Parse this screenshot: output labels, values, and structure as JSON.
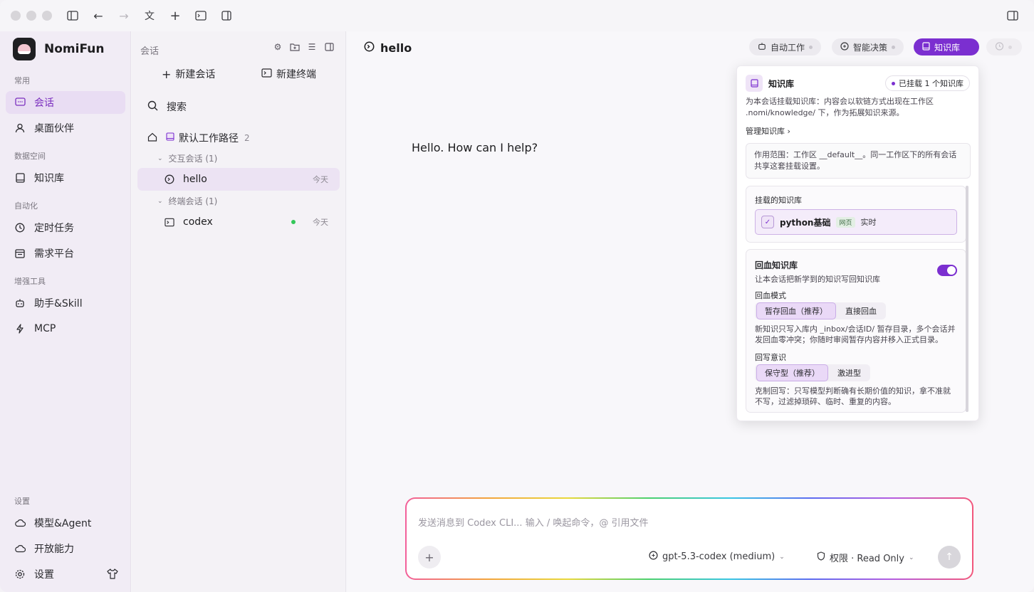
{
  "app": {
    "name": "NomiFun"
  },
  "sidebar": {
    "sections": [
      {
        "label": "常用",
        "items": [
          {
            "label": "会话",
            "icon": "chat-icon",
            "active": true
          },
          {
            "label": "桌面伙伴",
            "icon": "user-icon"
          }
        ]
      },
      {
        "label": "数据空间",
        "items": [
          {
            "label": "知识库",
            "icon": "book-icon"
          }
        ]
      },
      {
        "label": "自动化",
        "items": [
          {
            "label": "定时任务",
            "icon": "clock-icon"
          },
          {
            "label": "需求平台",
            "icon": "list-icon"
          }
        ]
      },
      {
        "label": "增强工具",
        "items": [
          {
            "label": "助手&Skill",
            "icon": "robot-icon"
          },
          {
            "label": "MCP",
            "icon": "bolt-icon"
          }
        ]
      }
    ],
    "bottom_label": "设置",
    "bottom_items": [
      {
        "label": "模型&Agent",
        "icon": "cloud-icon"
      },
      {
        "label": "开放能力",
        "icon": "cloud-icon"
      },
      {
        "label": "设置",
        "icon": "gear-icon"
      }
    ]
  },
  "panel": {
    "title": "会话",
    "new_session": "新建会话",
    "new_terminal": "新建终端",
    "search": "搜索",
    "workspace": {
      "name": "默认工作路径",
      "count": "2"
    },
    "groups": [
      {
        "label": "交互会话 (1)",
        "sessions": [
          {
            "name": "hello",
            "date": "今天",
            "icon": "chat-bubble-icon"
          }
        ]
      },
      {
        "label": "终端会话 (1)",
        "sessions": [
          {
            "name": "codex",
            "date": "今天",
            "icon": "terminal-icon",
            "online": true
          }
        ]
      }
    ]
  },
  "main": {
    "title": "hello",
    "pills": [
      {
        "label": "自动工作"
      },
      {
        "label": "智能决策"
      },
      {
        "label": "知识库"
      }
    ],
    "greeting": "Hello. How can I help?"
  },
  "popover": {
    "title": "知识库",
    "badge": "已挂载 1 个知识库",
    "desc_line1": "为本会话挂载知识库：内容会以软链方式出现在工作区",
    "desc_line2": ".nomi/knowledge/ 下，作为拓展知识来源。",
    "manage": "管理知识库 ›",
    "scope_line1": "作用范围：工作区 __default__。同一工作区下的所有会话",
    "scope_line2": "共享这套挂载设置。",
    "mounted_title": "挂载的知识库",
    "kb": {
      "name": "python基础",
      "tag": "网页",
      "mode": "实时"
    },
    "writeback_title": "回血知识库",
    "writeback_desc": "让本会话把新学到的知识写回知识库",
    "mode_label": "回血模式",
    "mode_options": [
      "暂存回血（推荐）",
      "直接回血"
    ],
    "mode_desc_line1": "新知识只写入库内 _inbox/会话ID/ 暂存目录，多个会话并",
    "mode_desc_line2": "发回血零冲突；你随时审阅暂存内容并移入正式目录。",
    "aware_label": "回写意识",
    "aware_options": [
      "保守型（推荐）",
      "激进型"
    ],
    "aware_desc_line1": "克制回写：只写模型判断确有长期价值的知识，拿不准就",
    "aware_desc_line2": "不写，过滤掉琐碎、临时、重复的内容。"
  },
  "composer": {
    "placeholder": "发送消息到 Codex CLI...  输入 / 唤起命令，@ 引用文件",
    "model": "gpt-5.3-codex (medium)",
    "permission": "权限 · Read Only"
  },
  "colors": {
    "accent": "#7b2fd0",
    "active_bg": "#e9ddf3",
    "online": "#34c759"
  }
}
